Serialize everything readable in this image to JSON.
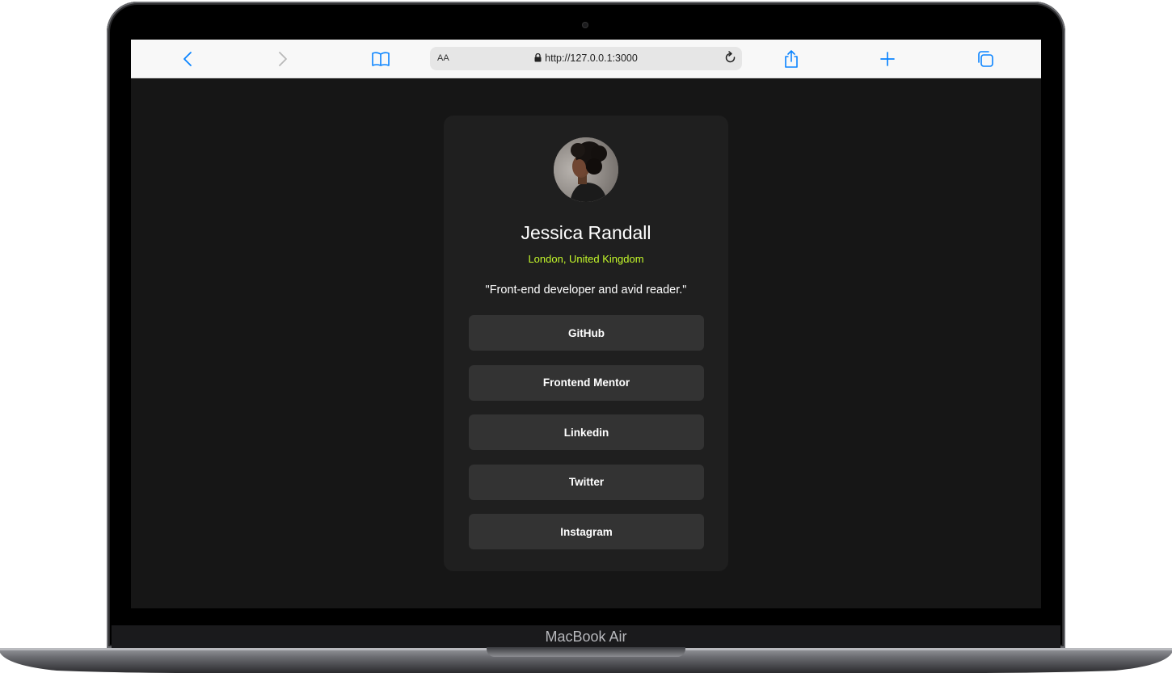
{
  "browser": {
    "reader_label": "AA",
    "url": "http://127.0.0.1:3000",
    "accent_color": "#0a84ff"
  },
  "device": {
    "label": "MacBook Air"
  },
  "profile": {
    "name": "Jessica Randall",
    "location": "London, United Kingdom",
    "bio": "\"Front-end developer and avid reader.\"",
    "location_color": "#c4f82a"
  },
  "links": [
    {
      "label": "GitHub"
    },
    {
      "label": "Frontend Mentor"
    },
    {
      "label": "Linkedin"
    },
    {
      "label": "Twitter"
    },
    {
      "label": "Instagram"
    }
  ]
}
